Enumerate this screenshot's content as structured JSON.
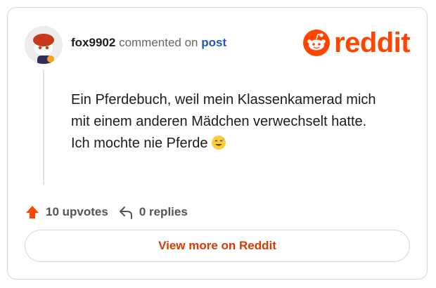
{
  "comment": {
    "username": "fox9902",
    "action_text": "commented on",
    "post_link": "post",
    "body_lines": [
      "Ein Pferdebuch, weil mein Klassenkamerad mich",
      "mit einem anderen Mädchen verwechselt hatte.",
      "Ich mochte nie Pferde"
    ]
  },
  "brand": {
    "wordmark": "reddit",
    "color": "#ff4500"
  },
  "stats": {
    "upvotes": "10 upvotes",
    "replies": "0 replies"
  },
  "cta": {
    "label": "View more on Reddit"
  },
  "colors": {
    "upvote": "#ff4500",
    "link": "#1f55c4",
    "cta": "#d93a00"
  },
  "icons": [
    "user-avatar-icon",
    "reddit-snoo-icon",
    "upvote-arrow-icon",
    "reply-arrow-icon",
    "sweat-smile-emoji-icon"
  ]
}
